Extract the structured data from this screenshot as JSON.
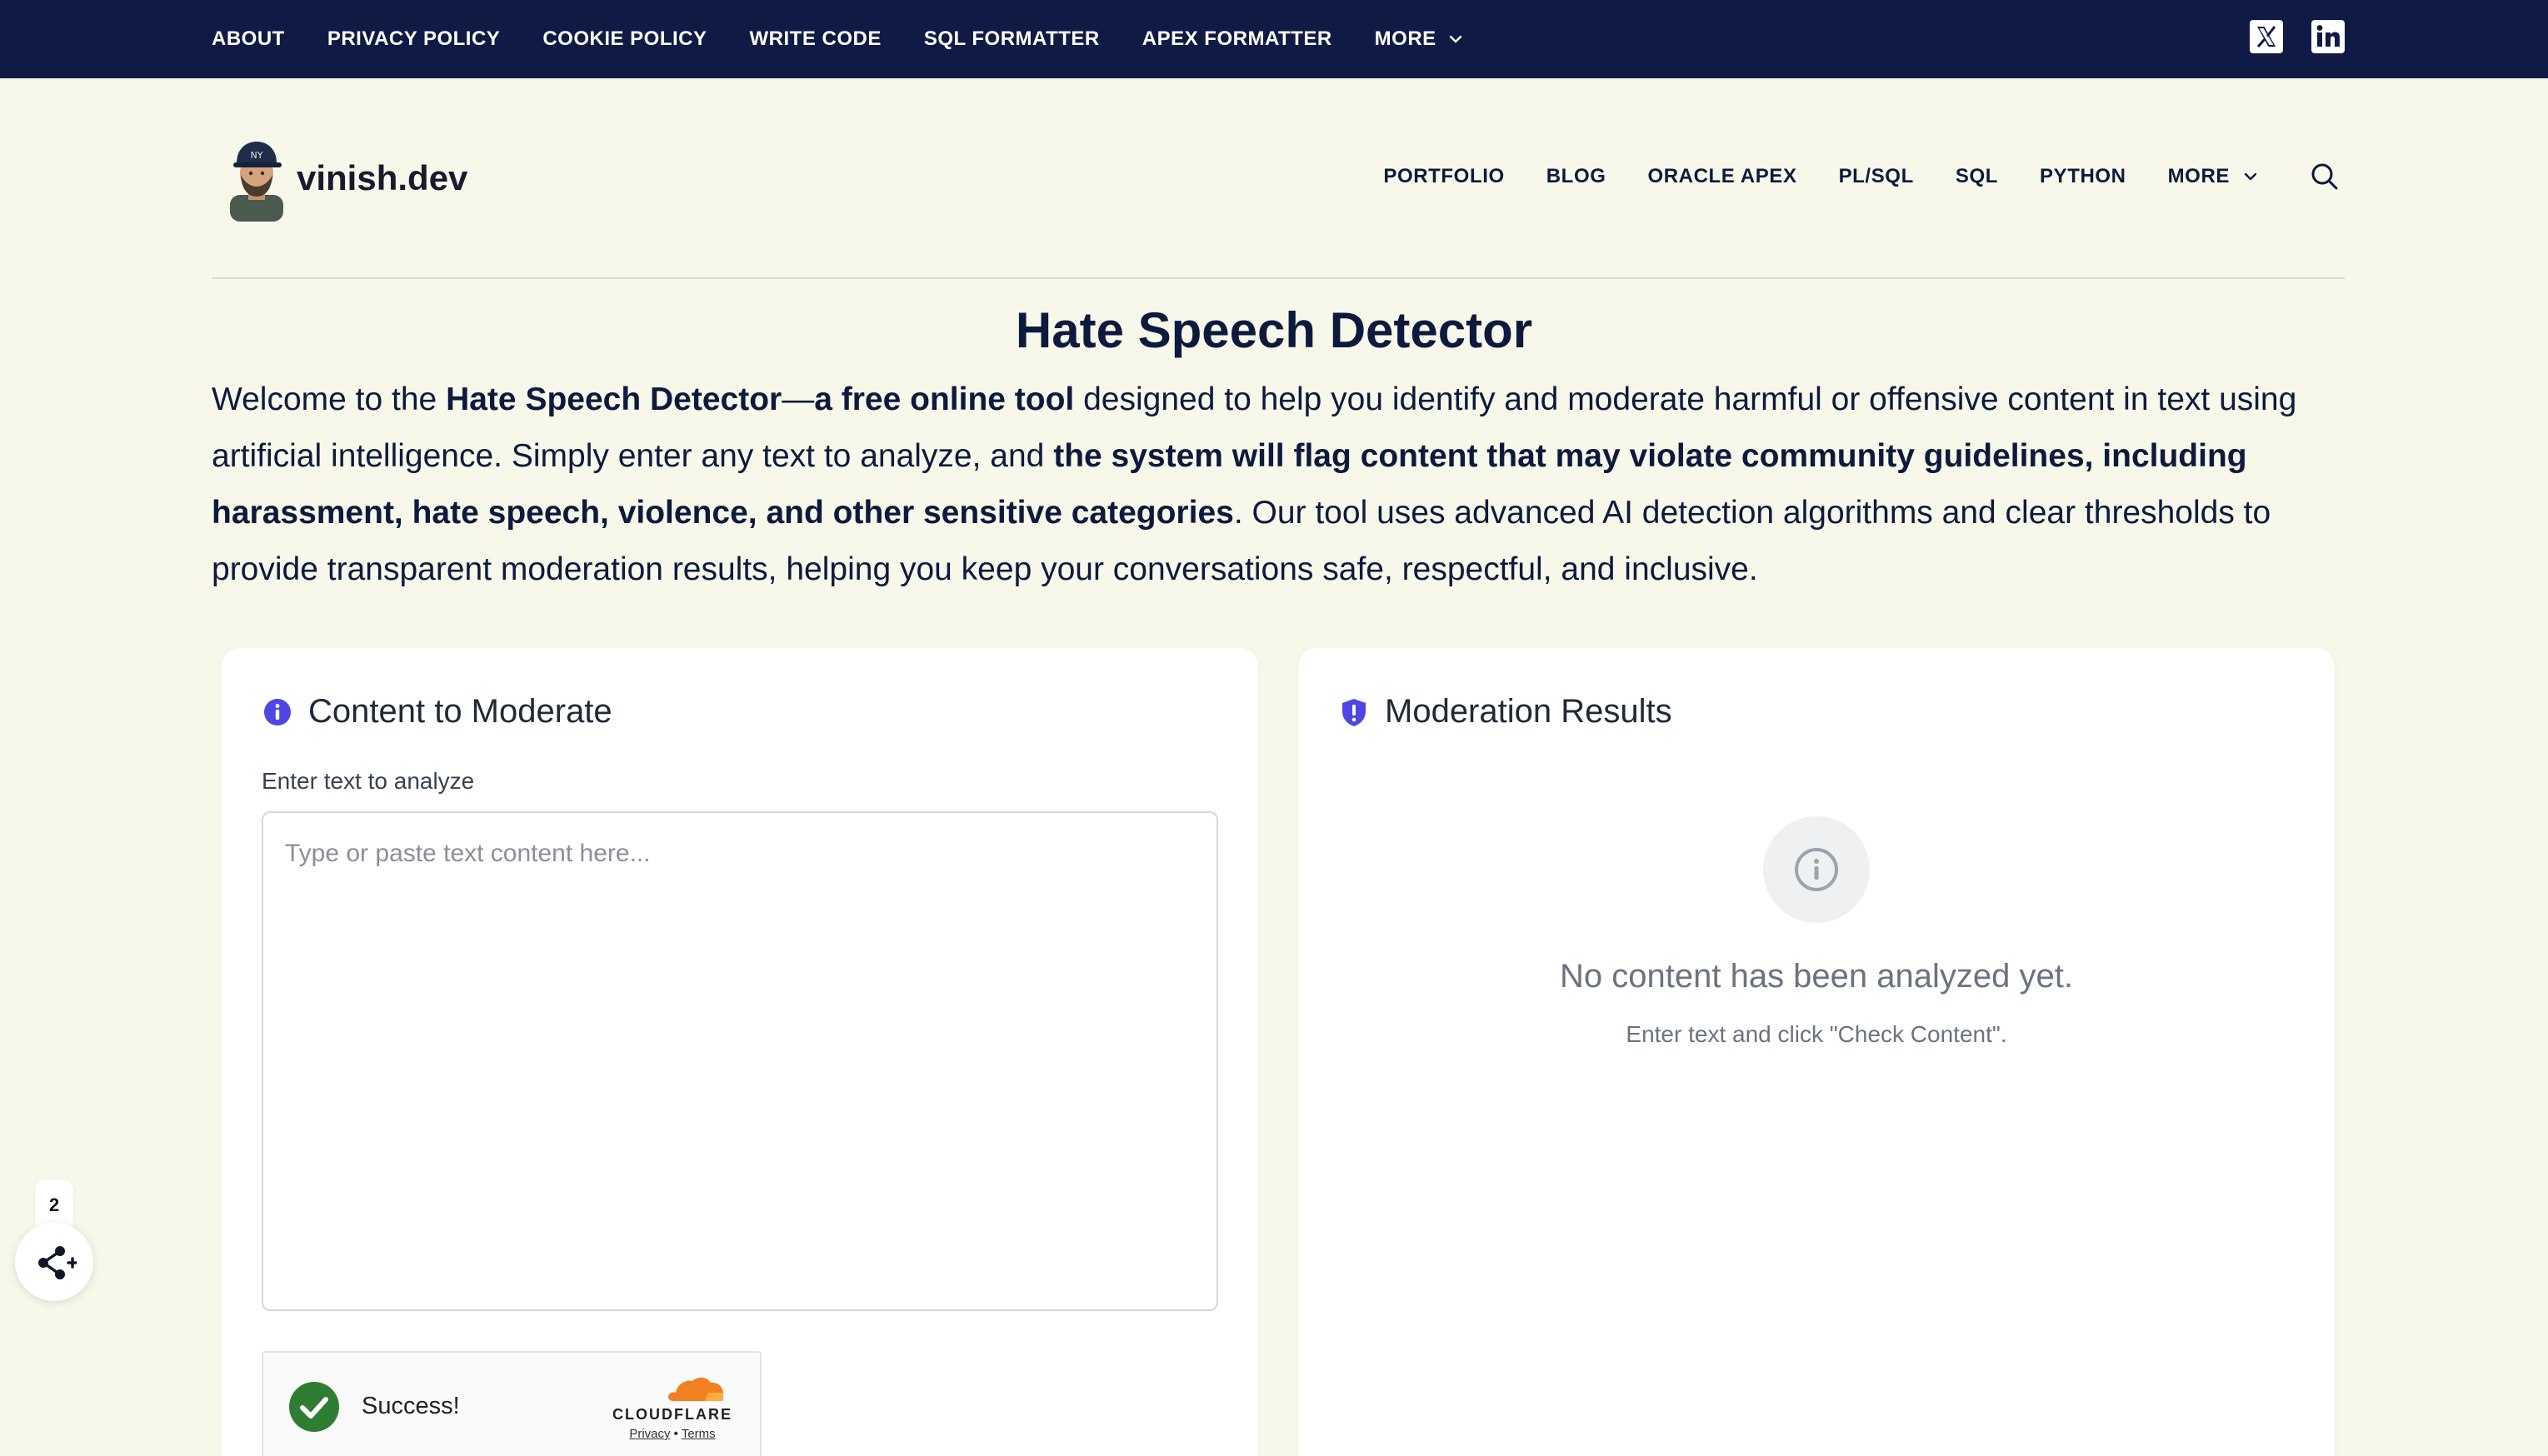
{
  "topbar": {
    "links": [
      "ABOUT",
      "PRIVACY POLICY",
      "COOKIE POLICY",
      "WRITE CODE",
      "SQL FORMATTER",
      "APEX FORMATTER",
      "MORE"
    ],
    "social": [
      "x-icon",
      "linkedin-icon"
    ]
  },
  "header": {
    "brand": "vinish.dev",
    "nav": [
      "PORTFOLIO",
      "BLOG",
      "ORACLE APEX",
      "PL/SQL",
      "SQL",
      "PYTHON",
      "MORE"
    ]
  },
  "hero": {
    "title": "Hate Speech Detector",
    "intro": {
      "p1": "Welcome to the ",
      "b1": "Hate Speech Detector",
      "p2": "—",
      "b2": "a free online tool",
      "p3": " designed to help you identify and moderate harmful or offensive content in text using artificial intelligence. Simply enter any text to analyze, and ",
      "b3": "the system will flag content that may violate community guidelines, including harassment, hate speech, violence, and other sensitive categories",
      "p4": ". Our tool uses advanced AI detection algorithms and clear thresholds to provide transparent moderation results, helping you keep your conversations safe, respectful, and inclusive."
    }
  },
  "left_card": {
    "title": "Content to Moderate",
    "field_label": "Enter text to analyze",
    "placeholder": "Type or paste text content here...",
    "value": "",
    "turnstile": {
      "status": "Success!",
      "brand": "CLOUDFLARE",
      "privacy": "Privacy",
      "sep": "•",
      "terms": "Terms"
    }
  },
  "right_card": {
    "title": "Moderation Results",
    "empty_title": "No content has been analyzed yet.",
    "empty_sub": "Enter text and click \"Check Content\"."
  },
  "share": {
    "count": "2"
  },
  "colors": {
    "topbar_bg": "#0f1b45",
    "page_bg": "#f7f7ea",
    "accent": "#4f46e5",
    "success": "#2f7d32",
    "cloudflare": "#f38020"
  }
}
